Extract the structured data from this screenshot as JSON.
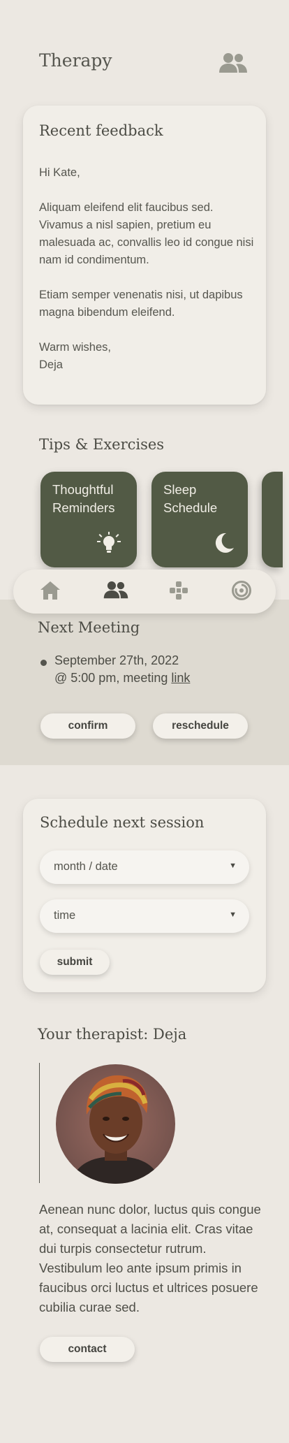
{
  "header": {
    "title": "Therapy",
    "icon": "people-icon"
  },
  "feedback": {
    "title": "Recent feedback",
    "greeting": "Hi Kate,",
    "paragraph1": "Aliquam eleifend elit faucibus sed. Vivamus a nisl sapien, pretium eu malesuada ac, convallis leo id congue nisi nam id condimentum.",
    "paragraph2": "Etiam semper venenatis nisi, ut dapibus magna bibendum eleifend.",
    "signoff": "Warm wishes,",
    "signature": "Deja"
  },
  "tips": {
    "title": "Tips & Exercises",
    "items": [
      {
        "label": "Thoughtful Reminders",
        "icon": "lightbulb-icon"
      },
      {
        "label": "Sleep Schedule",
        "icon": "moon-icon"
      }
    ]
  },
  "nav": {
    "items": [
      {
        "name": "home",
        "icon": "home-icon"
      },
      {
        "name": "therapy",
        "icon": "people-icon",
        "active": true
      },
      {
        "name": "games",
        "icon": "gamepad-icon"
      },
      {
        "name": "meditation",
        "icon": "spiral-icon"
      }
    ]
  },
  "meeting": {
    "title": "Next Meeting",
    "date_line": "September 27th, 2022",
    "time_line": "@ 5:00 pm, meeting ",
    "link_text": "link",
    "confirm_label": "confirm",
    "reschedule_label": "reschedule"
  },
  "schedule": {
    "title": "Schedule next session",
    "date_placeholder": "month / date",
    "time_placeholder": "time",
    "submit_label": "submit"
  },
  "therapist": {
    "title": "Your therapist: Deja",
    "bio": "Aenean nunc dolor, luctus quis congue at, consequat a lacinia elit. Cras vitae dui turpis consectetur rutrum. Vestibulum leo ante ipsum primis in faucibus orci luctus et ultrices posuere cubilia curae sed.",
    "contact_label": "contact"
  },
  "colors": {
    "background": "#ece8e2",
    "card": "#f1eee8",
    "accent_green": "#525a45",
    "band": "#dedad1",
    "text": "#4a4a44"
  }
}
